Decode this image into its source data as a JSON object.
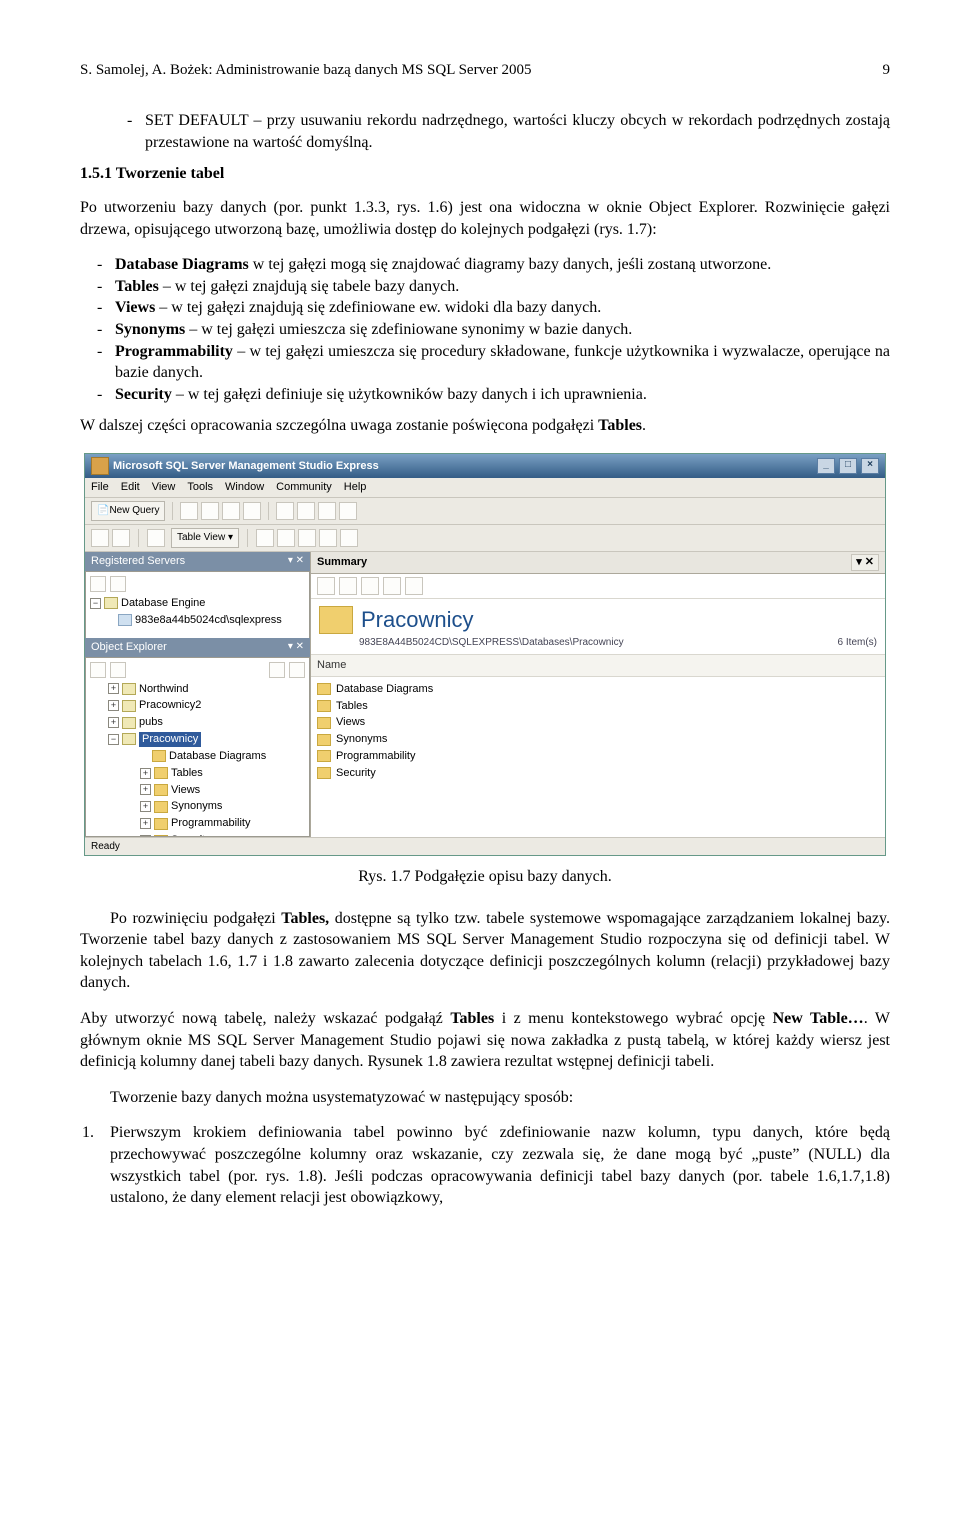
{
  "header": {
    "text": "S. Samolej, A. Bożek: Administrowanie bazą danych MS SQL Server 2005",
    "page": "9"
  },
  "intro_bullet": "SET DEFAULT – przy usuwaniu rekordu nadrzędnego, wartości kluczy obcych w rekordach podrzędnych zostają przestawione na wartość domyślną.",
  "section": "1.5.1   Tworzenie tabel",
  "p1": "Po utworzeniu bazy danych (por. punkt 1.3.3, rys. 1.6) jest ona widoczna w oknie Object Explorer. Rozwinięcie gałęzi drzewa, opisującego utworzoną bazę, umożliwia dostęp do kolejnych podgałęzi (rys. 1.7):",
  "bullets": [
    {
      "b": "Database Diagrams",
      "t": " w tej gałęzi mogą się znajdować diagramy bazy danych, jeśli zostaną utworzone."
    },
    {
      "b": "Tables",
      "t": " – w tej gałęzi znajdują się tabele bazy danych."
    },
    {
      "b": "Views",
      "t": " – w tej gałęzi znajdują się zdefiniowane ew. widoki dla bazy danych."
    },
    {
      "b": "Synonyms",
      "t": " – w tej gałęzi umieszcza się zdefiniowane synonimy w bazie danych."
    },
    {
      "b": "Programmability",
      "t": " – w tej gałęzi umieszcza się procedury składowane, funkcje użytkownika i wyzwalacze, operujące na bazie danych."
    },
    {
      "b": "Security",
      "t": " – w tej gałęzi definiuje się użytkowników bazy danych i ich uprawnienia."
    }
  ],
  "p2": "W dalszej części opracowania szczególna uwaga zostanie poświęcona podgałęzi ",
  "p2b": "Tables",
  "caption": "Rys. 1.7 Podgałęzie opisu bazy danych.",
  "p3a": "Po rozwinięciu podgałęzi ",
  "p3b": "Tables,",
  "p3c": " dostępne są tylko tzw. tabele systemowe wspomagające zarządzaniem lokalnej bazy. Tworzenie tabel bazy danych z zastosowaniem MS SQL Server Management Studio rozpoczyna się od definicji tabel. W kolejnych tabelach 1.6, 1.7 i 1.8 zawarto zalecenia dotyczące definicji poszczególnych kolumn (relacji) przykładowej bazy danych.",
  "p4a": "Aby utworzyć nową tabelę, należy wskazać podgałąź ",
  "p4b": "Tables",
  "p4c": " i z menu kontekstowego wybrać opcję ",
  "p4d": "New Table…",
  "p4e": ". W głównym oknie MS SQL Server Management Studio pojawi się nowa zakładka z pustą tabelą, w której każdy wiersz jest definicją kolumny danej tabeli bazy danych. Rysunek 1.8 zawiera rezultat wstępnej definicji tabeli.",
  "p5": "Tworzenie bazy danych można usystematyzować w następujący sposób:",
  "num1": "Pierwszym krokiem definiowania tabel powinno być zdefiniowanie nazw kolumn, typu danych, które będą przechowywać poszczególne kolumny oraz wskazanie, czy zezwala się, że dane mogą być „puste” (NULL) dla wszystkich tabel (por. rys. 1.8). Jeśli podczas opracowywania definicji tabel bazy danych (por. tabele 1.6,1.7,1.8) ustalono, że dany element relacji jest obowiązkowy,",
  "shot": {
    "title": "Microsoft SQL Server Management Studio Express",
    "menus": [
      "File",
      "Edit",
      "View",
      "Tools",
      "Window",
      "Community",
      "Help"
    ],
    "new_query": "New Query",
    "table_view": "Table View ▾",
    "reg_title": "Registered Servers",
    "reg_engine": "Database Engine",
    "reg_server": "983e8a44b5024cd\\sqlexpress",
    "obj_title": "Object Explorer",
    "tree": {
      "nw": "Northwind",
      "p2": "Pracownicy2",
      "pubs": "pubs",
      "sel": "Pracownicy",
      "dd": "Database Diagrams",
      "tb": "Tables",
      "vw": "Views",
      "sy": "Synonyms",
      "pg": "Programmability",
      "sc": "Security",
      "sc2": "Security"
    },
    "summary": "Summary",
    "big": "Pracownicy",
    "path": "983E8A44B5024CD\\SQLEXPRESS\\Databases\\Pracownicy",
    "items": "6 Item(s)",
    "col": "Name",
    "list": [
      "Database Diagrams",
      "Tables",
      "Views",
      "Synonyms",
      "Programmability",
      "Security"
    ],
    "status": "Ready"
  }
}
